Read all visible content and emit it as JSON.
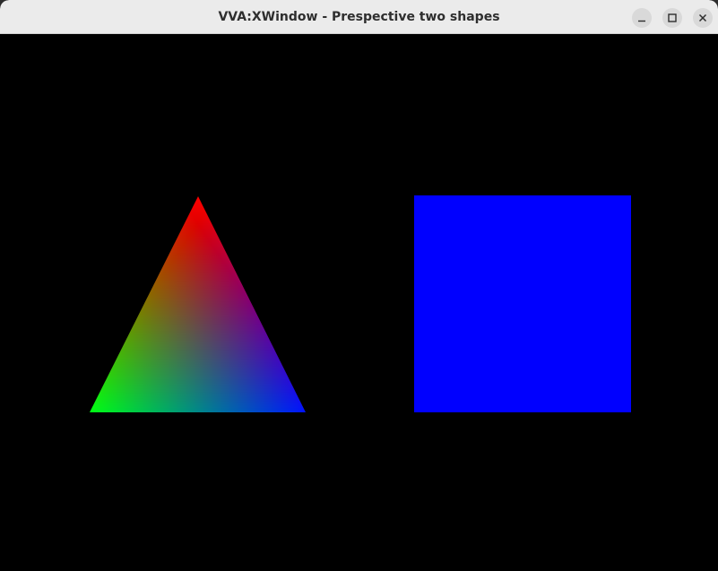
{
  "window": {
    "title": "VVA:XWindow - Prespective two shapes"
  },
  "controls": {
    "minimize_icon": "minimize-icon",
    "maximize_icon": "maximize-icon",
    "close_icon": "close-icon"
  },
  "scene": {
    "background_color": "#000000",
    "shapes": [
      {
        "kind": "triangle",
        "fill": "vertex-interpolated",
        "vertex_colors": [
          "#ff0000",
          "#00ff00",
          "#0000ff"
        ]
      },
      {
        "kind": "square",
        "fill": "#0000ff"
      }
    ]
  }
}
